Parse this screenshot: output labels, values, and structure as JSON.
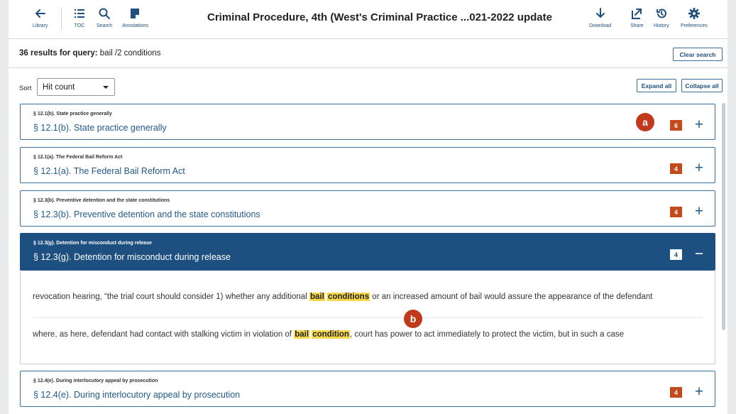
{
  "toolbar": {
    "left_buttons": [
      {
        "label": "Library",
        "icon": "arrow-left-icon"
      },
      {
        "label": "TOC",
        "icon": "list-icon"
      },
      {
        "label": "Search",
        "icon": "search-icon"
      },
      {
        "label": "Annotations",
        "icon": "annotation-icon"
      }
    ],
    "title": "Criminal Procedure, 4th (West's Criminal Practice ...021-2022 update",
    "right_buttons": [
      {
        "label": "Download",
        "icon": "download-icon"
      },
      {
        "label": "Share",
        "icon": "share-icon"
      },
      {
        "label": "History",
        "icon": "history-icon"
      },
      {
        "label": "Preferences",
        "icon": "gear-icon"
      }
    ]
  },
  "results": {
    "count_text": "36 results for query:",
    "query": "bail /2 conditions",
    "clear_label": "Clear search"
  },
  "sort": {
    "label": "Sort",
    "selected": "Hit count"
  },
  "controls": {
    "expand_all": "Expand all",
    "collapse_all": "Collapse all"
  },
  "items": [
    {
      "small": "§ 12.1(b). State practice generally",
      "title": "§ 12.1(b). State practice generally",
      "hits": "6",
      "toggle": "+"
    },
    {
      "small": "§ 12.1(a). The Federal Bail Reform Act",
      "title": "§ 12.1(a). The Federal Bail Reform Act",
      "hits": "4",
      "toggle": "+"
    },
    {
      "small": "§ 12.3(b). Preventive detention and the state constitutions",
      "title": "§ 12.3(b). Preventive detention and the state constitutions",
      "hits": "4",
      "toggle": "+"
    },
    {
      "small": "§ 12.3(g). Detention for misconduct during release",
      "title": "§ 12.3(g). Detention for misconduct during release",
      "hits": "4",
      "toggle": "−"
    },
    {
      "small": "§ 12.4(e). During interlocutory appeal by prosecution",
      "title": "§ 12.4(e). During interlocutory appeal by prosecution",
      "hits": "4",
      "toggle": "+"
    }
  ],
  "snippets": [
    {
      "before": "revocation hearing, “the trial court should consider 1) whether any additional ",
      "hl1": "bail",
      "hl2": "conditions",
      "after": " or an increased amount of bail would assure the appearance of the defendant"
    },
    {
      "before": "where, as here, defendant had contact with stalking victim in violation of ",
      "hl1": "bail",
      "hl2": "condition",
      "after": ", court has power to act immediately to protect the victim, but in such a case"
    }
  ],
  "callouts": [
    "a",
    "b"
  ],
  "colors": {
    "accent": "#1d4f81",
    "link": "#1f5a8c",
    "hit_badge": "#c24a1b",
    "highlight": "#f5d94a",
    "callout": "#c1391c"
  }
}
